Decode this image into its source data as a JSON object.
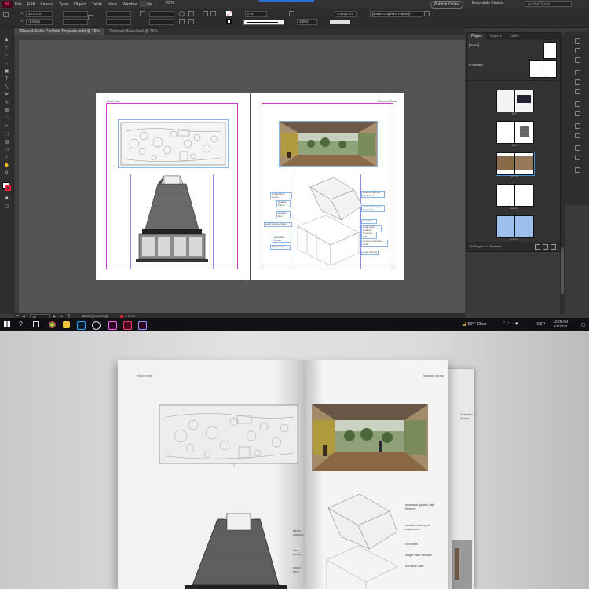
{
  "app": {
    "logo": "Id",
    "menu": [
      "File",
      "Edit",
      "Layout",
      "Type",
      "Object",
      "Table",
      "View",
      "Window",
      "Help"
    ],
    "zoom": "75%",
    "publish_label": "Publish Online",
    "workspace": "Essentials Classic",
    "help_search_placeholder": "Adobe Stock"
  },
  "control_bar": {
    "x": "22.6 cm",
    "y": "-1.9 cm",
    "stroke_weight": "0 pt",
    "opacity": "100%",
    "width_cm": "0.4233 cm",
    "frame_style": "[Basic Graphics Frame]+"
  },
  "tabs": [
    {
      "label": "*Shaw & Sollie Portfolio Template.indd @ 75%",
      "active": true
    },
    {
      "label": "Template Base.indd @ 75%",
      "active": false
    }
  ],
  "spread": {
    "left_header": "Short Tube",
    "right_header": "Selected Works",
    "notes": [
      "shaded from sunset",
      "window frame",
      "wooden floor",
      "south facing window",
      "ground/at sunset",
      "folding board",
      "seasonal garden, tall flowers",
      "window looking at watershed",
      "roof tube",
      "single bark window",
      "common wall",
      "wooden mountain/ south",
      "wood framing"
    ]
  },
  "status_bar": {
    "page": "10",
    "master": "[Basic] (working)",
    "errors": "1 error"
  },
  "pages_panel": {
    "tabs": [
      "Pages",
      "Layers",
      "Links"
    ],
    "none_label": "[None]",
    "master_label": "A-Master",
    "spreads": [
      "6-7",
      "8-9",
      "10-11",
      "12-13",
      "14-15"
    ],
    "footer": "15 Pages in 8 Spreads"
  },
  "taskbar": {
    "weather": "50°F Clear",
    "lang": "ESP",
    "time": "12:29 AM",
    "date": "5/1/2022"
  },
  "mockup": {
    "left_header": "Short Tube",
    "right_header": "Selected Works",
    "back_header": "Selected Works",
    "notes": [
      "seasonal garden, tall flowers",
      "window looking at watershed",
      "roof tube",
      "single bark window",
      "common wall"
    ],
    "left_notes": [
      "folder window",
      "roof beam",
      "wood floor"
    ]
  },
  "colors": {
    "accent_indesign": "#ff3366",
    "margin_guide": "#d23bd6",
    "column_guide": "#8a8af0",
    "frame_blue": "#8ab4e6"
  }
}
